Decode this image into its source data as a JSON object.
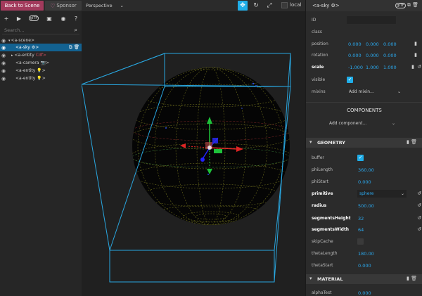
{
  "topbar": {
    "back_label": "Back to Scene",
    "sponsor_label": "Sponsor",
    "perspective_label": "Perspective",
    "local_label": "local"
  },
  "scenegraph": {
    "search_placeholder": "Search...",
    "rows": [
      {
        "label": "<a-scene>",
        "extra": "",
        "icon": ""
      },
      {
        "label": "<a-sky",
        "extra": "",
        "icon": "⚙>"
      },
      {
        "label": "<a-entity",
        "extra": "Cdf>",
        "icon": ""
      },
      {
        "label": "<a-camera",
        "extra": "",
        "icon": "📷>"
      },
      {
        "label": "<a-entity",
        "extra": "",
        "icon": "💡>"
      },
      {
        "label": "<a-entity",
        "extra": "",
        "icon": "💡>"
      }
    ]
  },
  "inspector": {
    "title": "<a-sky",
    "title_icon": "⚙>",
    "id_label": "ID",
    "class_label": "class",
    "position_label": "position",
    "position": [
      "0.000",
      "0.000",
      "0.000"
    ],
    "rotation_label": "rotation",
    "rotation": [
      "0.000",
      "0.000",
      "0.000"
    ],
    "scale_label": "scale",
    "scale": [
      "-1.000",
      "1.000",
      "1.000"
    ],
    "visible_label": "visible",
    "mixins_label": "mixins",
    "mixins_placeholder": "Add mixin...",
    "components_title": "COMPONENTS",
    "add_component_label": "Add component...",
    "geometry_title": "GEOMETRY",
    "geometry": {
      "buffer_label": "buffer",
      "phiLength_label": "phiLength",
      "phiLength": "360.00",
      "phiStart_label": "phiStart",
      "phiStart": "0.000",
      "primitive_label": "primitive",
      "primitive": "sphere",
      "radius_label": "radius",
      "radius": "500.00",
      "segmentsHeight_label": "segmentsHeight",
      "segmentsHeight": "32",
      "segmentsWidth_label": "segmentsWidth",
      "segmentsWidth": "64",
      "skipCache_label": "skipCache",
      "thetaLength_label": "thetaLength",
      "thetaLength": "180.00",
      "thetaStart_label": "thetaStart",
      "thetaStart": "0.000"
    },
    "material_title": "MATERIAL",
    "material": {
      "alphaTest_label": "alphaTest",
      "alphaTest": "0.000"
    }
  },
  "colors": {
    "accent": "#1faee9",
    "value_blue": "#2ba9ef",
    "back_button": "#a23a5c",
    "selection": "#136291",
    "bbox": "#29a6df"
  }
}
